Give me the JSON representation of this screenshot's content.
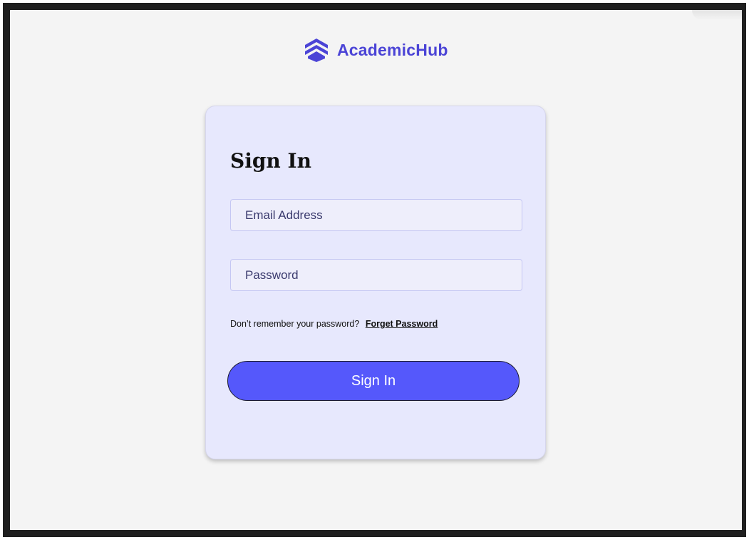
{
  "brand": {
    "name": "AcademicHub",
    "logo_icon": "stacked-chevrons-icon",
    "color": "#4b44d6"
  },
  "card": {
    "title": "Sign In",
    "background": "#e7e8fd"
  },
  "email": {
    "placeholder": "Email Address",
    "value": ""
  },
  "password": {
    "placeholder": "Password",
    "value": ""
  },
  "forgot": {
    "prompt": "Don’t remember your password?",
    "link_label": "Forget Password"
  },
  "submit": {
    "label": "Sign In",
    "color": "#5558fb"
  }
}
